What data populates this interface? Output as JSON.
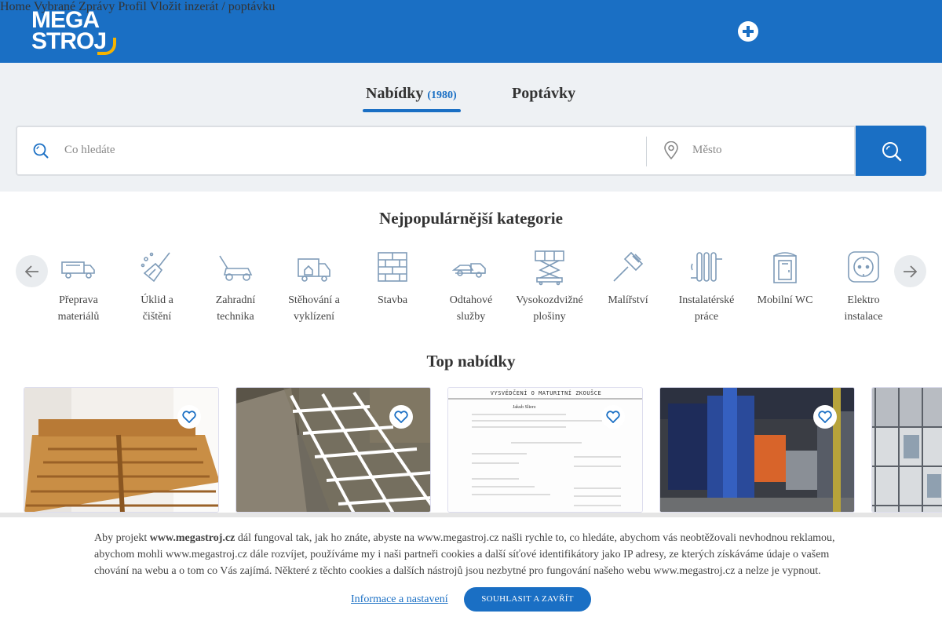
{
  "header": {
    "logo_line1": "MEGA",
    "logo_line2": "STROJ",
    "nav": [
      "Home",
      "Vybrané",
      "Zprávy",
      "Profil"
    ],
    "post_label": "Vložit",
    "post_link": "inzerát / poptávku"
  },
  "search": {
    "tabs": [
      {
        "label": "Nabídky",
        "count": "(1980)",
        "active": true
      },
      {
        "label": "Poptávky",
        "active": false
      }
    ],
    "query_placeholder": "Co hledáte",
    "city_placeholder": "Město"
  },
  "categories": {
    "title": "Nejpopulárnější kategorie",
    "items": [
      {
        "line1": "Přeprava",
        "line2": "materiálů",
        "icon": "truck-icon"
      },
      {
        "line1": "Úklid a",
        "line2": "čištění",
        "icon": "broom-icon"
      },
      {
        "line1": "Zahradní",
        "line2": "technika",
        "icon": "lawnmower-icon"
      },
      {
        "line1": "Stěhování a",
        "line2": "vyklízení",
        "icon": "moving-truck-icon"
      },
      {
        "line1": "Stavba",
        "line2": "",
        "icon": "brick-wall-icon"
      },
      {
        "line1": "Odtahové",
        "line2": "služby",
        "icon": "tow-truck-icon"
      },
      {
        "line1": "Vysokozdvižné",
        "line2": "plošiny",
        "icon": "scissor-lift-icon"
      },
      {
        "line1": "Malířství",
        "line2": "",
        "icon": "paint-brush-icon"
      },
      {
        "line1": "Instalatérské",
        "line2": "práce",
        "icon": "radiator-icon"
      },
      {
        "line1": "Mobilní WC",
        "line2": "",
        "icon": "portable-toilet-icon"
      },
      {
        "line1": "Elektro",
        "line2": "instalace",
        "icon": "power-socket-icon"
      }
    ]
  },
  "offers": {
    "title": "Top nabídky",
    "cards": [
      {
        "image": "wooden-bed-photo"
      },
      {
        "image": "metal-grid-photo"
      },
      {
        "image": "certificate-document-photo",
        "doc_heading": "VYSVĚDČENÍ O MATURITNÍ ZKOUŠCE",
        "doc_name": "Jakub Slierz"
      },
      {
        "image": "industrial-machine-photo"
      },
      {
        "image": "scaffolding-photo"
      }
    ]
  },
  "cookie": {
    "text_before": "Aby projekt ",
    "site_bold": "www.megastroj.cz",
    "text_after": " dál fungoval tak, jak ho znáte, abyste na www.megastroj.cz našli rychle to, co hledáte, abychom vás neobtěžovali nevhodnou reklamou, abychom mohli www.megastroj.cz dále rozvíjet, používáme my i naši partneři cookies a další síťové identifikátory jako IP adresy, ze kterých získáváme údaje o vašem chování na webu a o tom co Vás zajímá. Některé z těchto cookies a dalších nástrojů jsou nezbytné pro fungování našeho webu www.megastroj.cz a nelze je vypnout.",
    "settings_link": "Informace a nastavení",
    "accept_button": "SOUHLASIT A ZAVŘÍT"
  },
  "colors": {
    "primary": "#1a6fc4",
    "logo_accent": "#f5b300",
    "icon_stroke": "#7e9bb8"
  }
}
